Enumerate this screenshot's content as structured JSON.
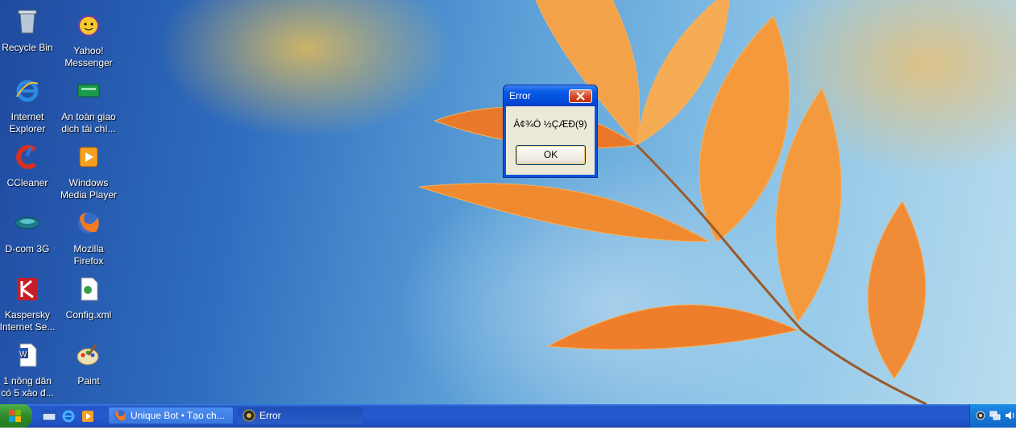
{
  "desktop": {
    "icons": [
      {
        "label": "Recycle Bin",
        "icon": "recycle-bin-icon"
      },
      {
        "label": "Yahoo!\nMessenger",
        "icon": "yahoo-messenger-icon"
      },
      {
        "label": "Internet\nExplorer",
        "icon": "internet-explorer-icon"
      },
      {
        "label": "An toàn giao\ndịch tài chí...",
        "icon": "bank-card-icon"
      },
      {
        "label": "CCleaner",
        "icon": "ccleaner-icon"
      },
      {
        "label": "Windows\nMedia Player",
        "icon": "media-player-icon"
      },
      {
        "label": "D-com 3G",
        "icon": "dcom-3g-icon"
      },
      {
        "label": "Mozilla\nFirefox",
        "icon": "firefox-icon"
      },
      {
        "label": "Kaspersky\nInternet Se...",
        "icon": "kaspersky-icon"
      },
      {
        "label": "Config.xml",
        "icon": "xml-file-icon"
      },
      {
        "label": "1 nông dân\ncó 5 xào đ...",
        "icon": "word-document-icon"
      },
      {
        "label": "Paint",
        "icon": "paint-icon"
      }
    ]
  },
  "dialog": {
    "title": "Error",
    "message": "Á¢¾Ó ½ÇÆÐ(9)",
    "ok_label": "OK"
  },
  "taskbar": {
    "quick_launch": [
      "show-desktop-icon",
      "internet-explorer-icon",
      "media-player-icon"
    ],
    "tasks": [
      {
        "label": "Unique Bot • Tạo ch...",
        "icon": "firefox-icon"
      },
      {
        "label": "Error",
        "icon": "app-icon"
      }
    ],
    "tray_icons": [
      "settings-icon",
      "network-icon",
      "volume-icon"
    ]
  },
  "colors": {
    "taskbar": "#245ad0",
    "start": "#2e8a2b",
    "dialog_title": "#0048d6",
    "dialog_body": "#ece9d8"
  }
}
